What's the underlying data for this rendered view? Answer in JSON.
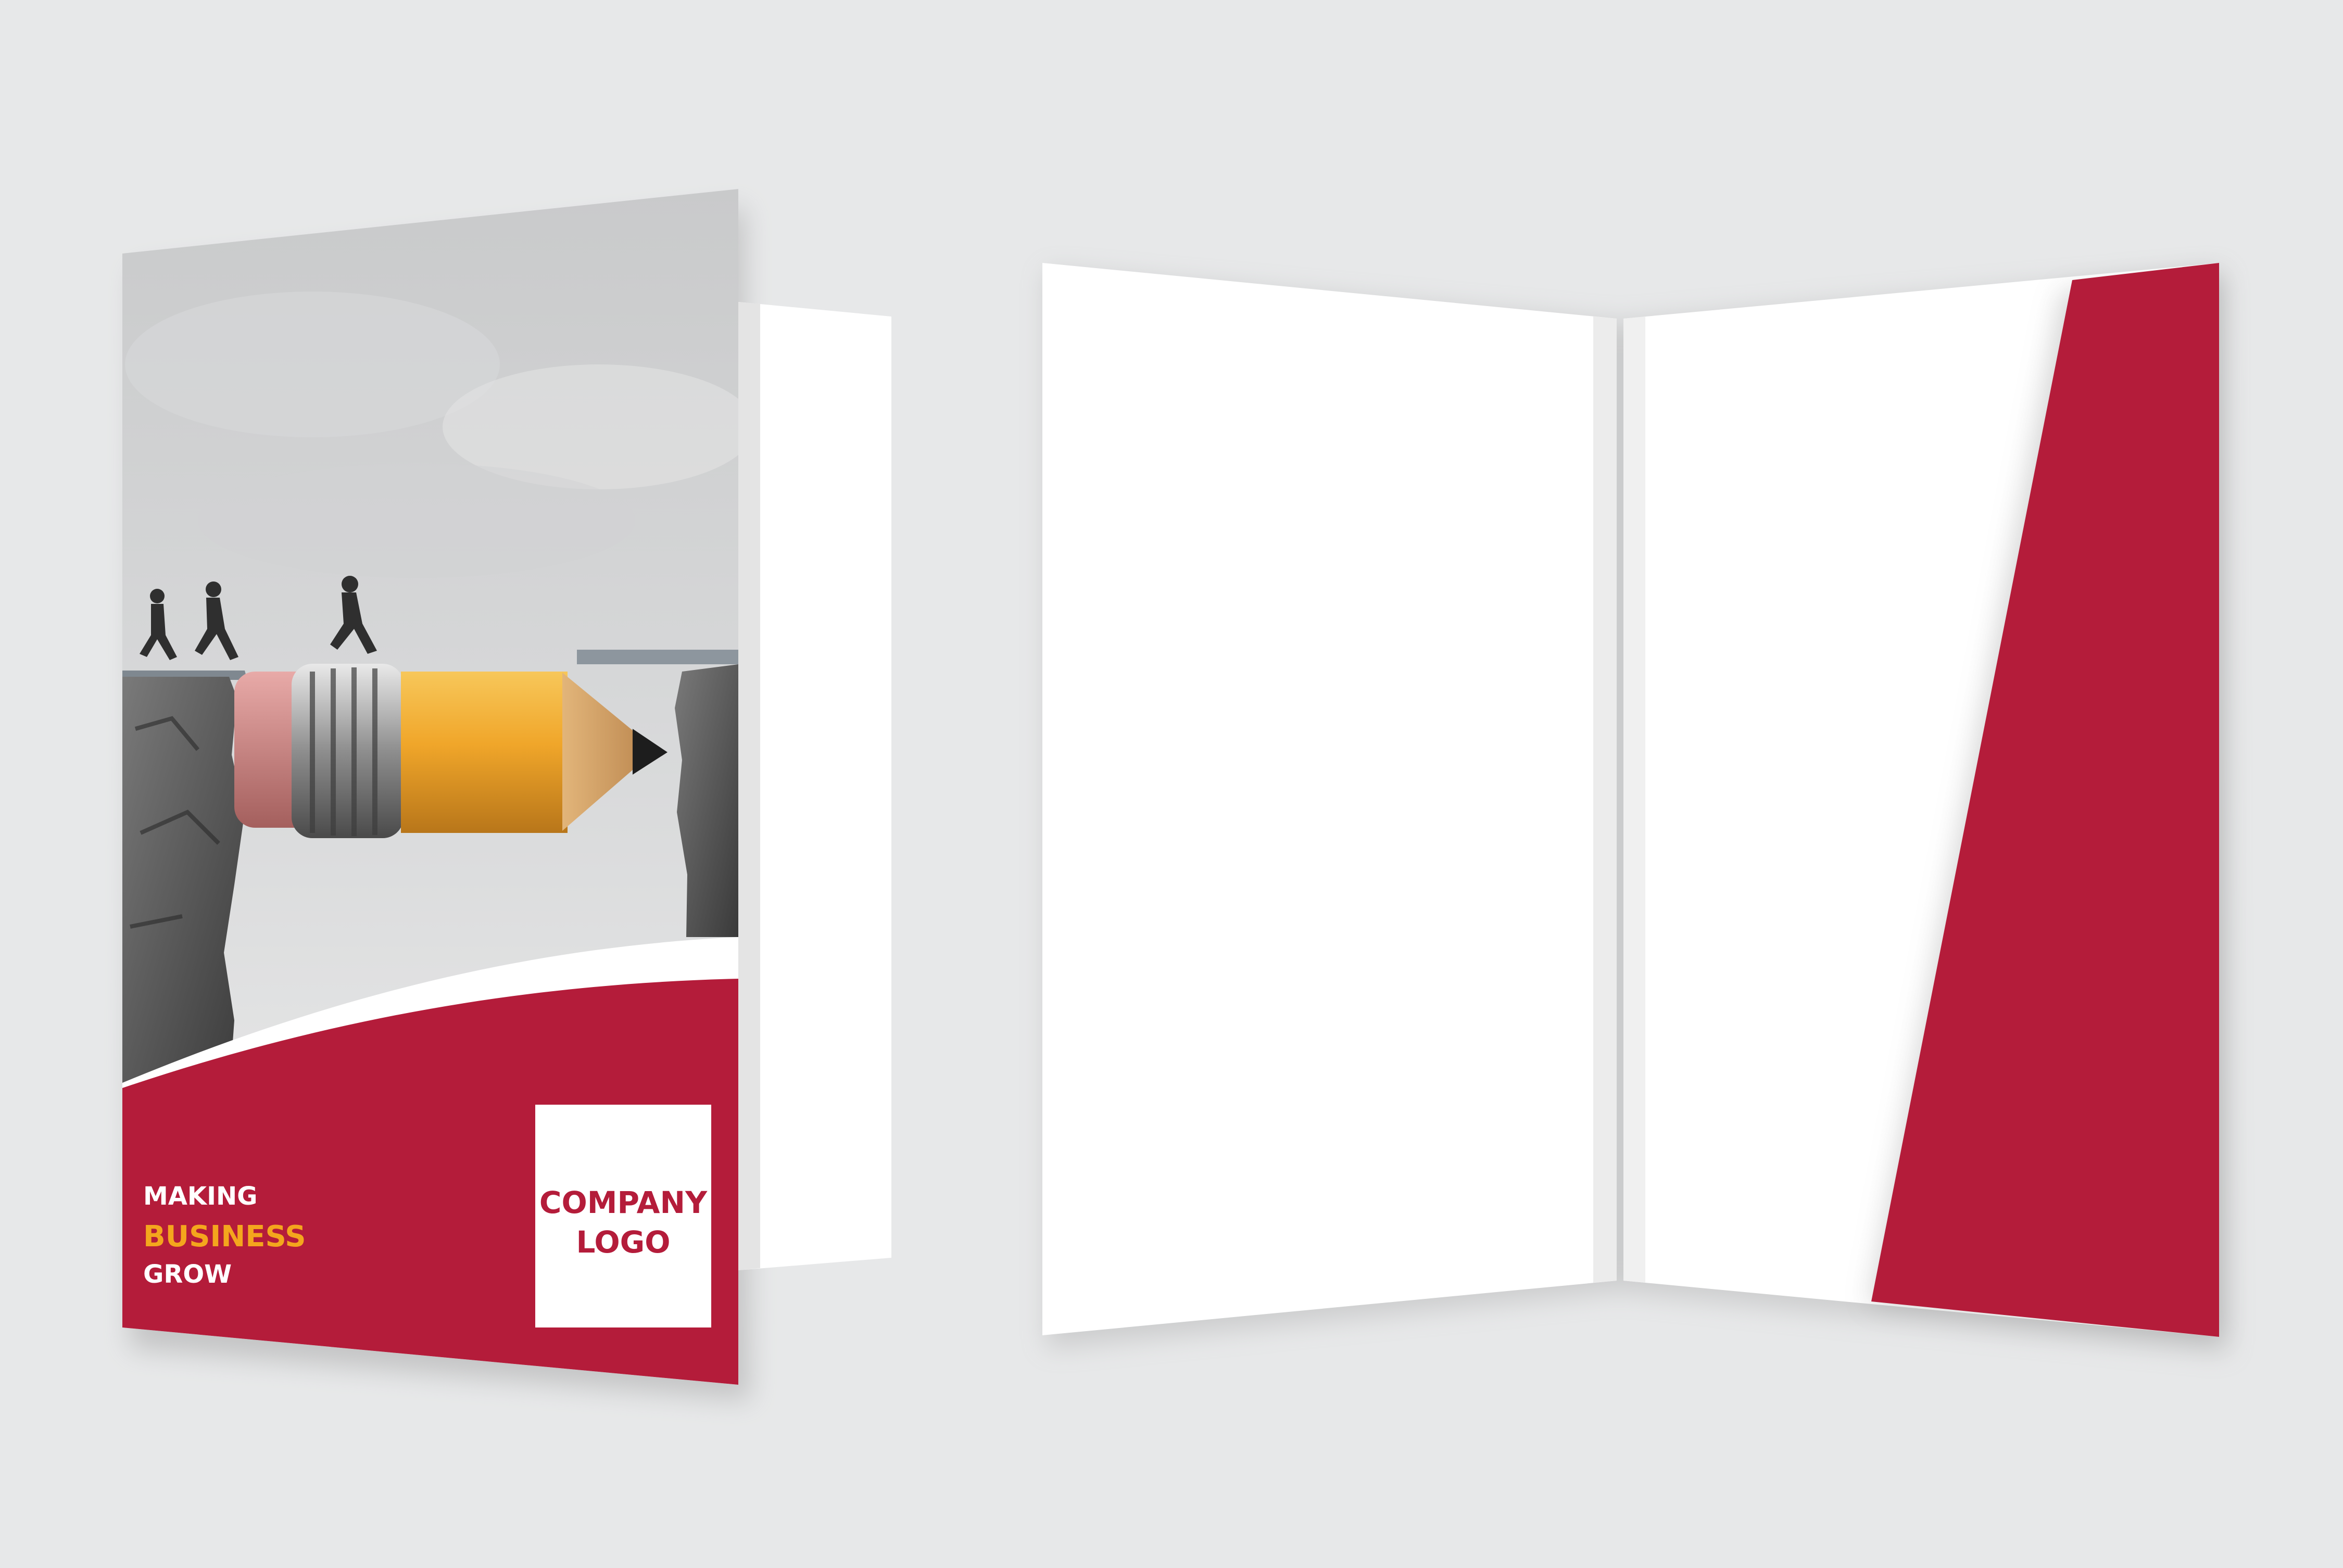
{
  "scene": {
    "description_visible": false
  },
  "front_cover": {
    "tagline_line1": "MAKING",
    "tagline_line2": "BUSINESS",
    "tagline_line3": "GROW",
    "logo_line1": "COMPANY",
    "logo_line2": "LOGO"
  },
  "colors": {
    "background": "#e7e8e9",
    "brand_red": "#b41c3a",
    "accent_orange": "#f4a61d",
    "paper_white": "#ffffff",
    "sky_gray": "#cfd0d1"
  },
  "icons": [
    "pencil-illustration",
    "running-people-illustration",
    "cliff-illustration"
  ]
}
